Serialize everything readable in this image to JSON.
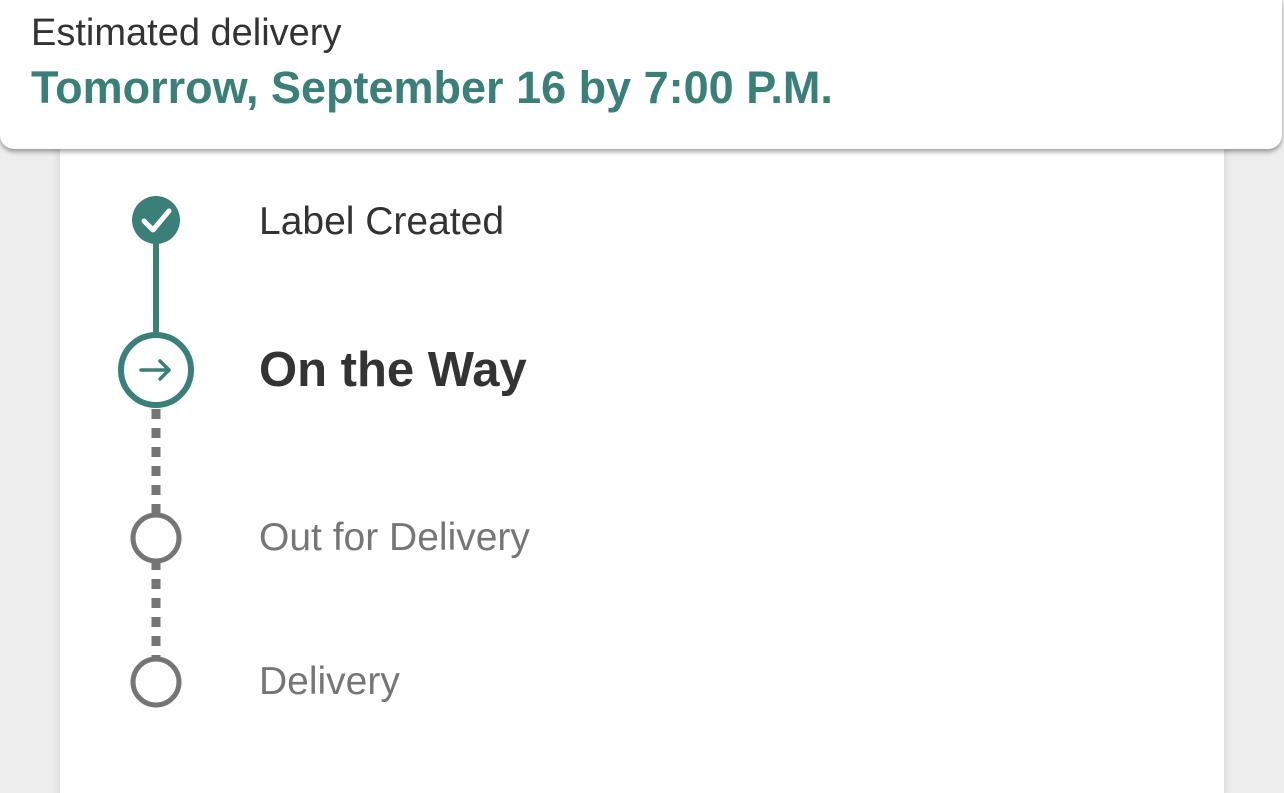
{
  "header": {
    "label": "Estimated delivery",
    "value": "Tomorrow, September 16 by 7:00 P.M."
  },
  "tracking": {
    "steps": [
      {
        "label": "Label Created",
        "status": "completed",
        "icon": "check-icon"
      },
      {
        "label": "On the Way",
        "status": "current",
        "icon": "arrow-right-icon"
      },
      {
        "label": "Out for Delivery",
        "status": "pending",
        "icon": "empty-circle-icon"
      },
      {
        "label": "Delivery",
        "status": "pending",
        "icon": "empty-circle-icon"
      }
    ]
  },
  "colors": {
    "accent": "#3a8078",
    "text_primary": "#333333",
    "text_muted": "#767676",
    "pending_gray": "#757575",
    "background": "#eeeeee",
    "card": "#ffffff"
  }
}
